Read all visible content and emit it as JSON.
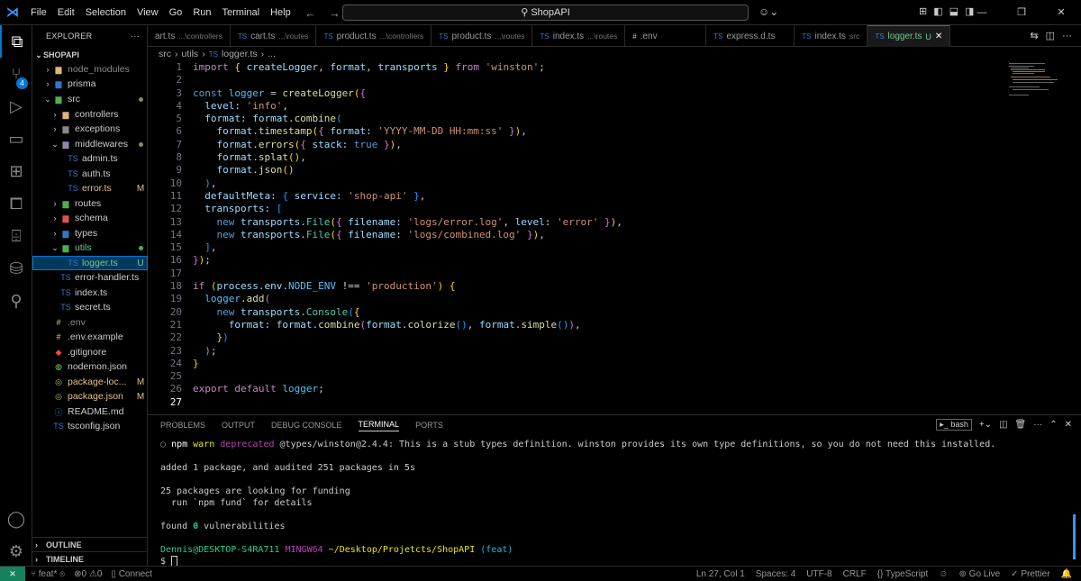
{
  "menu": [
    "File",
    "Edit",
    "Selection",
    "View",
    "Go",
    "Run",
    "Terminal",
    "Help"
  ],
  "search": {
    "label": "ShopAPI"
  },
  "sidebar": {
    "title": "EXPLORER",
    "project": "SHOPAPI",
    "items": [
      {
        "name": "node_modules",
        "status": ""
      },
      {
        "name": "prisma",
        "status": ""
      },
      {
        "name": "src",
        "status": ""
      },
      {
        "name": "controllers",
        "status": ""
      },
      {
        "name": "exceptions",
        "status": ""
      },
      {
        "name": "middlewares",
        "status": ""
      },
      {
        "name": "admin.ts",
        "status": ""
      },
      {
        "name": "auth.ts",
        "status": ""
      },
      {
        "name": "error.ts",
        "status": "M"
      },
      {
        "name": "routes",
        "status": ""
      },
      {
        "name": "schema",
        "status": ""
      },
      {
        "name": "types",
        "status": ""
      },
      {
        "name": "utils",
        "status": ""
      },
      {
        "name": "logger.ts",
        "status": "U"
      },
      {
        "name": "error-handler.ts",
        "status": ""
      },
      {
        "name": "index.ts",
        "status": ""
      },
      {
        "name": "secret.ts",
        "status": ""
      },
      {
        "name": ".env",
        "status": ""
      },
      {
        "name": ".env.example",
        "status": ""
      },
      {
        "name": ".gitignore",
        "status": ""
      },
      {
        "name": "nodemon.json",
        "status": ""
      },
      {
        "name": "package-loc...",
        "status": "M"
      },
      {
        "name": "package.json",
        "status": "M"
      },
      {
        "name": "README.md",
        "status": ""
      },
      {
        "name": "tsconfig.json",
        "status": ""
      }
    ],
    "outline": "OUTLINE",
    "timeline": "TIMELINE"
  },
  "tabs": [
    {
      "name": "art.ts",
      "dir": "...\\controllers"
    },
    {
      "name": "cart.ts",
      "dir": "...\\routes"
    },
    {
      "name": "product.ts",
      "dir": "...\\controllers"
    },
    {
      "name": "product.ts",
      "dir": "...\\routes"
    },
    {
      "name": "index.ts",
      "dir": "...\\routes"
    },
    {
      "name": ".env",
      "dir": ""
    },
    {
      "name": "express.d.ts",
      "dir": ""
    },
    {
      "name": "index.ts",
      "dir": "src"
    },
    {
      "name": "logger.ts",
      "dir": "U"
    }
  ],
  "breadcrumb": [
    "src",
    "utils",
    "logger.ts",
    "..."
  ],
  "line_numbers": [
    "1",
    "2",
    "3",
    "4",
    "5",
    "6",
    "7",
    "8",
    "9",
    "10",
    "11",
    "12",
    "13",
    "14",
    "15",
    "16",
    "17",
    "18",
    "19",
    "20",
    "21",
    "22",
    "23",
    "24",
    "25",
    "26",
    "27"
  ],
  "code": {
    "l1a": "import",
    "l1b": "createLogger",
    "l1c": "format",
    "l1d": "transports",
    "l1e": "from",
    "l1f": "'winston'",
    "l3a": "const",
    "l3b": "logger",
    "l3c": "createLogger",
    "l4a": "level:",
    "l4b": "'info'",
    "l5a": "format:",
    "l5b": "format",
    "l5c": "combine",
    "l6a": "format",
    "l6b": "timestamp",
    "l6c": "format:",
    "l6d": "'YYYY-MM-DD HH:mm:ss'",
    "l7a": "format",
    "l7b": "errors",
    "l7c": "stack:",
    "l7d": "true",
    "l8a": "format",
    "l8b": "splat",
    "l9a": "format",
    "l9b": "json",
    "l11a": "defaultMeta:",
    "l11b": "service:",
    "l11c": "'shop-api'",
    "l12a": "transports:",
    "l13a": "new",
    "l13b": "transports",
    "l13c": "File",
    "l13d": "filename:",
    "l13e": "'logs/error.log'",
    "l13f": "level:",
    "l13g": "'error'",
    "l14a": "new",
    "l14b": "transports",
    "l14c": "File",
    "l14d": "filename:",
    "l14e": "'logs/combined.log'",
    "l18a": "if",
    "l18b": "process",
    "l18c": "env",
    "l18d": "NODE_ENV",
    "l18e": "!==",
    "l18f": "'production'",
    "l19a": "logger",
    "l19b": "add",
    "l20a": "new",
    "l20b": "transports",
    "l20c": "Console",
    "l21a": "format:",
    "l21b": "format",
    "l21c": "combine",
    "l21d": "format",
    "l21e": "colorize",
    "l21f": "format",
    "l21g": "simple",
    "l26a": "export",
    "l26b": "default",
    "l26c": "logger"
  },
  "panel": {
    "tabs": [
      "PROBLEMS",
      "OUTPUT",
      "DEBUG CONSOLE",
      "TERMINAL",
      "PORTS"
    ],
    "shell": "bash",
    "terminal": {
      "warn_npm": "npm",
      "warn_word": "warn",
      "warn_dep": "deprecated",
      "warn_msg": "@types/winston@2.4.4: This is a stub types definition. winston provides its own type definitions, so you do not need this installed.",
      "added": "added 1 package, and audited 251 packages in 5s",
      "funding1": "25 packages are looking for funding",
      "funding2": "  run `npm fund` for details",
      "vuln_a": "found ",
      "vuln_b": "0",
      "vuln_c": " vulnerabilities",
      "user": "Dennis@DESKTOP-S4RA711",
      "env": "MINGW64",
      "path": "~/Desktop/Projetcts/ShopAPI",
      "branch": "(feat)",
      "prompt": "$"
    }
  },
  "status": {
    "branch": "feat*",
    "errors": "0",
    "warnings": "0",
    "connect": "Connect",
    "position": "Ln 27, Col 1",
    "spaces": "Spaces: 4",
    "encoding": "UTF-8",
    "eol": "CRLF",
    "language": "TypeScript",
    "golive": "Go Live",
    "prettier": "Prettier"
  },
  "colors": {
    "accent": "#0078d4",
    "remote": "#16825d",
    "modified": "#e2c08d"
  }
}
